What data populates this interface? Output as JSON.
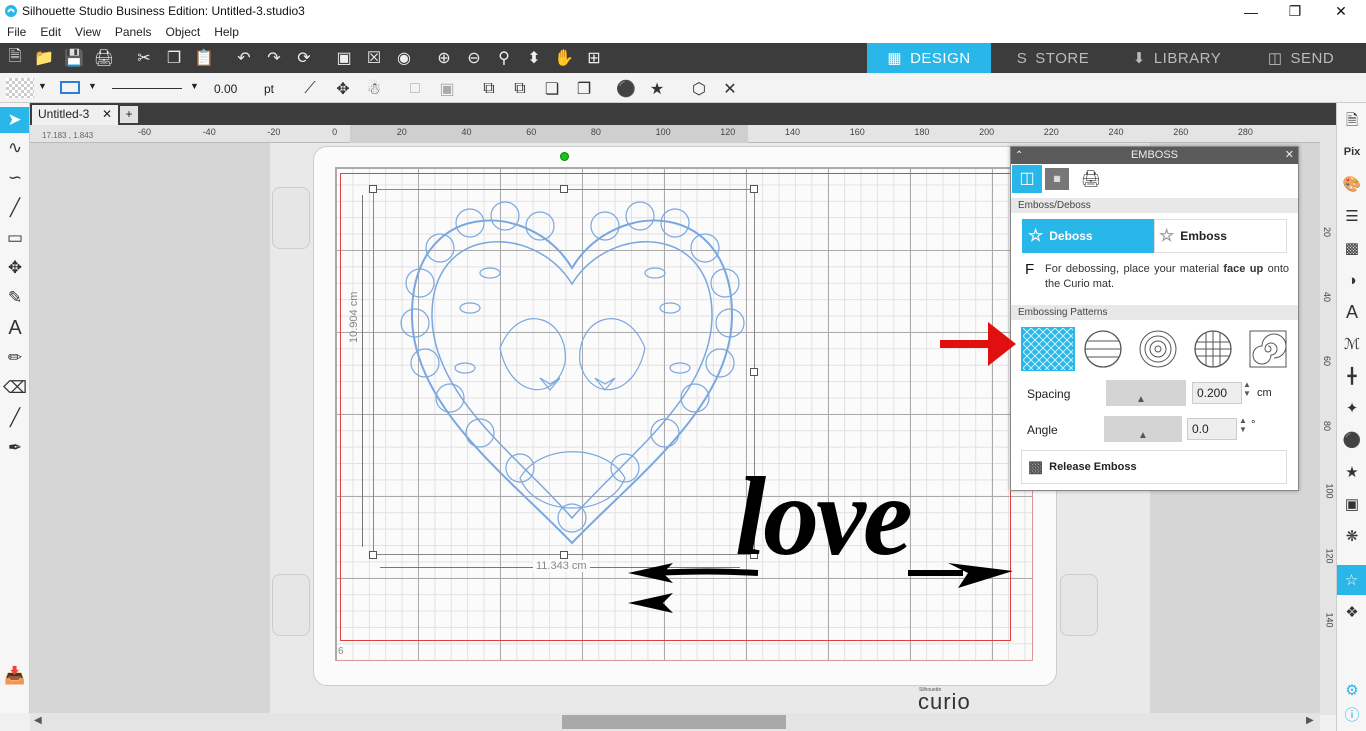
{
  "app": {
    "title": "Silhouette Studio Business Edition: Untitled-3.studio3"
  },
  "menu": [
    "File",
    "Edit",
    "View",
    "Panels",
    "Object",
    "Help"
  ],
  "nav_tabs": [
    {
      "label": "DESIGN"
    },
    {
      "label": "STORE"
    },
    {
      "label": "LIBRARY"
    },
    {
      "label": "SEND"
    }
  ],
  "toolbar2": {
    "line_width": "0.00",
    "unit": "pt"
  },
  "document": {
    "tab": "Untitled-3",
    "coords": "17.183 , 1.843"
  },
  "ruler": {
    "h": [
      "-60",
      "-40",
      "-20",
      "0",
      "20",
      "40",
      "60",
      "80",
      "100",
      "120",
      "140",
      "160",
      "180",
      "200",
      "220",
      "240",
      "260",
      "280"
    ],
    "v": [
      "20",
      "40",
      "60",
      "80",
      "100",
      "120",
      "140"
    ]
  },
  "selection": {
    "height": "10.904 cm",
    "width": "11.343 cm"
  },
  "design_text": "love",
  "mat": {
    "page_number": "6",
    "brand_small": "Silhouette",
    "brand": "curio"
  },
  "panel": {
    "title": "EMBOSS",
    "section1": "Emboss/Deboss",
    "deboss": "Deboss",
    "emboss": "Emboss",
    "info_icon": "F",
    "info_pre": "For debossing, place your material ",
    "info_bold": "face up",
    "info_post": " onto the Curio mat.",
    "section2": "Embossing Patterns",
    "spacing_label": "Spacing",
    "spacing_value": "0.200",
    "spacing_unit": "cm",
    "angle_label": "Angle",
    "angle_value": "0.0",
    "angle_unit": "°",
    "release": "Release Emboss"
  },
  "colors": {
    "accent": "#29b6e8",
    "arrow": "#e01010"
  }
}
